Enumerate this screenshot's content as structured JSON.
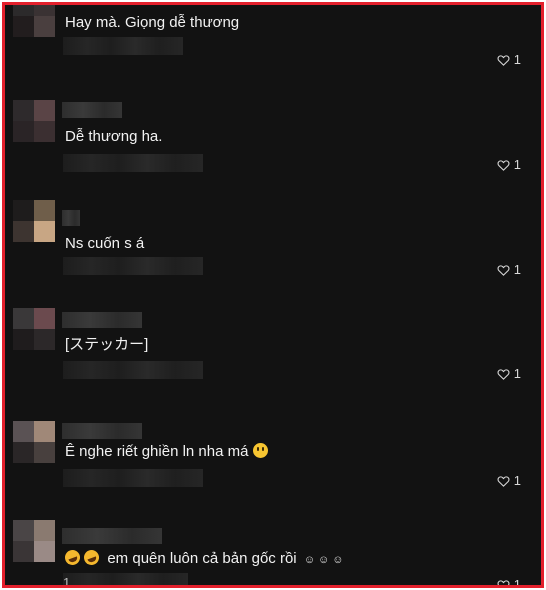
{
  "comments": [
    {
      "text": "Hay mà. Giọng dễ thương",
      "likes": "1"
    },
    {
      "text": "Dễ thương ha.",
      "likes": "1"
    },
    {
      "text": "Ns cuốn s á",
      "likes": "1"
    },
    {
      "text": "[ステッカー]",
      "likes": "1"
    },
    {
      "text": "Ê nghe riết ghiền ln nha má",
      "likes": "1"
    },
    {
      "text": "em quên luôn cả bản gốc rồi",
      "likes": "1",
      "meta_digit": "1"
    }
  ],
  "colors": {
    "background": "#121212",
    "border": "#e3202c",
    "text": "#f2f2f2"
  },
  "icons": [
    "heart-icon",
    "grinning-face-emoji-icon",
    "rolling-laughing-emoji-icon",
    "smiley-emoji-icon"
  ]
}
